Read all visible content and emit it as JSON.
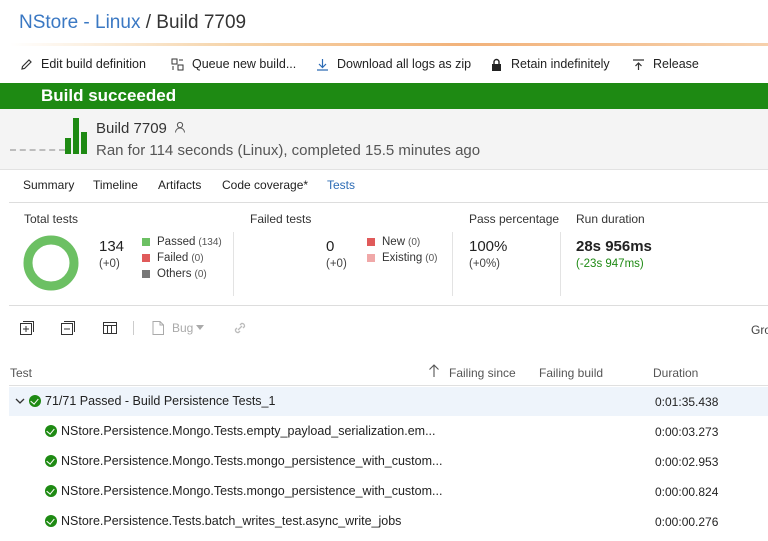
{
  "breadcrumb": {
    "project": "NStore - Linux",
    "separator": " / ",
    "build": "Build 7709"
  },
  "toolbar": {
    "edit": "Edit build definition",
    "queue": "Queue new build...",
    "download": "Download all logs as zip",
    "retain": "Retain indefinitely",
    "release": "Release"
  },
  "banner": {
    "status": "Build succeeded",
    "color": "#1e8a13"
  },
  "build": {
    "title": "Build 7709",
    "subtitle": "Ran for 114 seconds (Linux), completed 15.5 minutes ago"
  },
  "tabs": [
    "Summary",
    "Timeline",
    "Artifacts",
    "Code coverage*",
    "Tests"
  ],
  "active_tab": "Tests",
  "stats": {
    "total": {
      "label": "Total tests",
      "value": "134",
      "delta": "(+0)"
    },
    "legend": [
      {
        "label": "Passed",
        "count": "(134)",
        "color": "#6cc063"
      },
      {
        "label": "Failed",
        "count": "(0)",
        "color": "#e05a5a"
      },
      {
        "label": "Others",
        "count": "(0)",
        "color": "#777777"
      }
    ],
    "failed": {
      "label": "Failed tests",
      "value": "0",
      "delta": "(+0)"
    },
    "failed_legend": [
      {
        "label": "New",
        "count": "(0)",
        "color": "#e05a5a"
      },
      {
        "label": "Existing",
        "count": "(0)",
        "color": "#f0a8a8"
      }
    ],
    "pass": {
      "label": "Pass percentage",
      "value": "100%",
      "delta": "(+0%)"
    },
    "run": {
      "label": "Run duration",
      "value": "28s 956ms",
      "delta": "(-23s 947ms)"
    },
    "donut_fraction": 1.0
  },
  "actions": {
    "bug": "Bug",
    "group": "Gro"
  },
  "columns": {
    "test": "Test",
    "failing_since": "Failing since",
    "failing_build": "Failing build",
    "duration": "Duration"
  },
  "rows": [
    {
      "name": "71/71 Passed - Build Persistence Tests_1",
      "duration": "0:01:35.438",
      "group": true
    },
    {
      "name": "NStore.Persistence.Mongo.Tests.empty_payload_serialization.em...",
      "duration": "0:00:03.273"
    },
    {
      "name": "NStore.Persistence.Mongo.Tests.mongo_persistence_with_custom...",
      "duration": "0:00:02.953"
    },
    {
      "name": "NStore.Persistence.Mongo.Tests.mongo_persistence_with_custom...",
      "duration": "0:00:00.824"
    },
    {
      "name": "NStore.Persistence.Tests.batch_writes_test.async_write_jobs",
      "duration": "0:00:00.276"
    }
  ]
}
